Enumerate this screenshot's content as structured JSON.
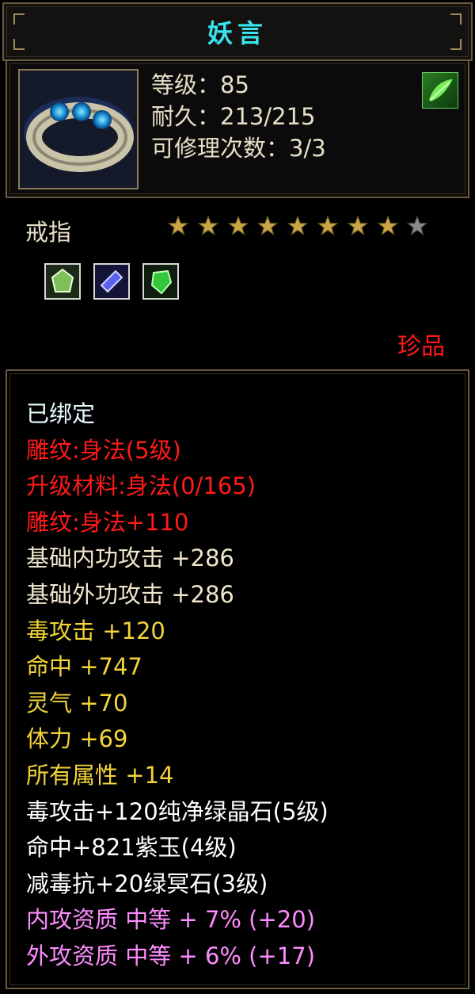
{
  "window": {
    "title": "妖言"
  },
  "item": {
    "icon": "ring-icon",
    "stats": [
      "等级：85",
      "耐久：213/215",
      "可修理次数：3/3"
    ],
    "badge_icon": "green-leaf-badge-icon",
    "type": "戒指",
    "stars": {
      "filled": 8,
      "total": 9
    },
    "gems": [
      {
        "icon": "green-crystal-gem-icon",
        "color": "#4f9a3a"
      },
      {
        "icon": "purple-jade-gem-icon",
        "color": "#4f55d8"
      },
      {
        "icon": "green-emerald-gem-icon",
        "color": "#3ac23a"
      }
    ],
    "rarity": "珍品"
  },
  "attributes": [
    {
      "text": "已绑定",
      "color": "#e8fbff"
    },
    {
      "text": "雕纹:身法(5级)",
      "color": "#ff1a1a"
    },
    {
      "text": "升级材料:身法(0/165)",
      "color": "#ff1a1a"
    },
    {
      "text": "雕纹:身法+110",
      "color": "#ff1a1a"
    },
    {
      "text": "基础内功攻击 +286",
      "color": "#f0e6cc"
    },
    {
      "text": "基础外功攻击 +286",
      "color": "#f0e6cc"
    },
    {
      "text": "毒攻击 +120",
      "color": "#f2d43a"
    },
    {
      "text": "命中 +747",
      "color": "#f2d43a"
    },
    {
      "text": "灵气 +70",
      "color": "#f2d43a"
    },
    {
      "text": "体力 +69",
      "color": "#f2d43a"
    },
    {
      "text": "所有属性 +14",
      "color": "#f2d43a"
    },
    {
      "text": "毒攻击+120纯净绿晶石(5级)",
      "color": "#ffffff"
    },
    {
      "text": "命中+821紫玉(4级)",
      "color": "#ffffff"
    },
    {
      "text": "减毒抗+20绿冥石(3级)",
      "color": "#ffffff"
    },
    {
      "text": "内攻资质 中等 + 7% (+20)",
      "color": "#ff8cff"
    },
    {
      "text": "外攻资质 中等 + 6% (+17)",
      "color": "#ff8cff"
    }
  ]
}
